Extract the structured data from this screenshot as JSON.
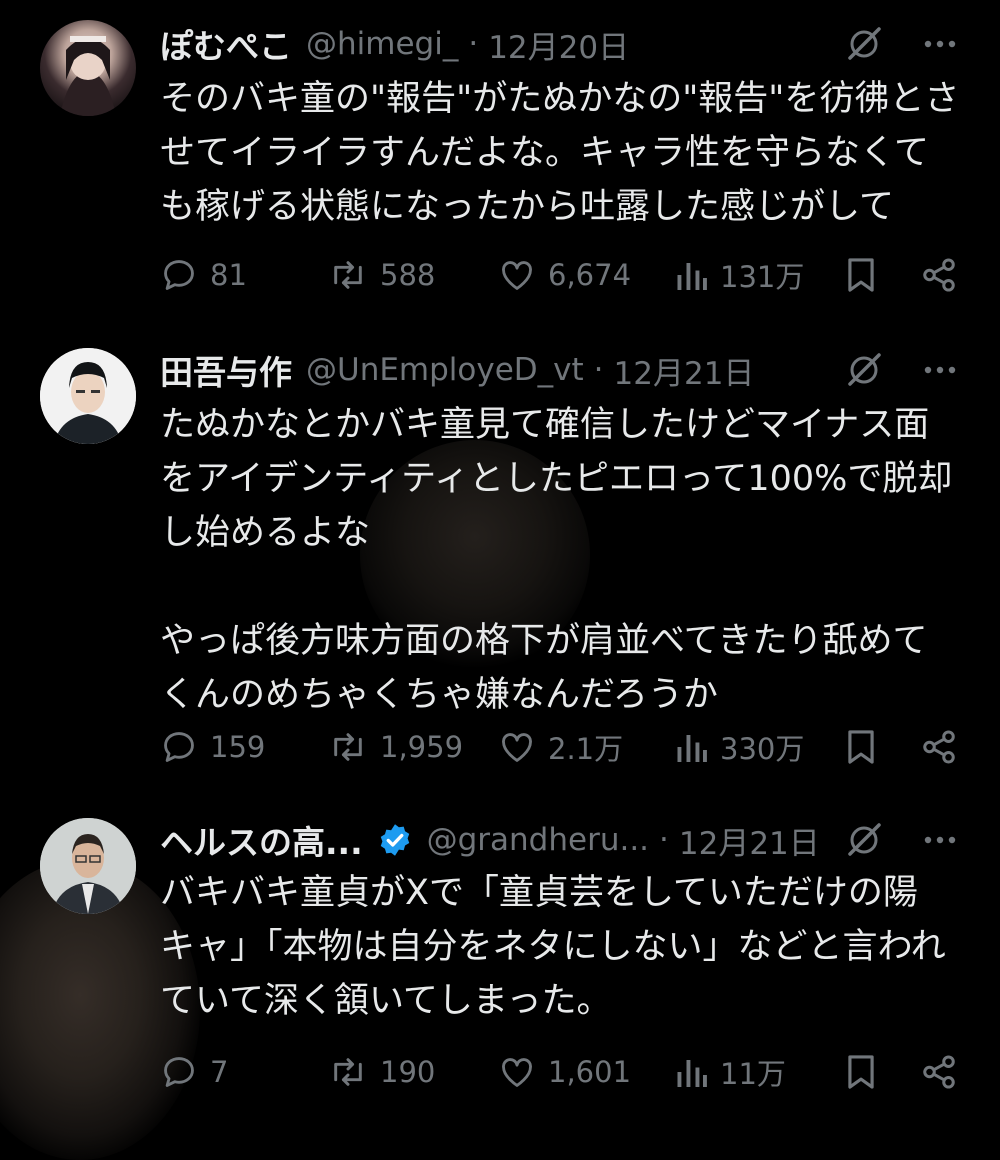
{
  "tweets": [
    {
      "name": "ぽむぺこ",
      "handle": "@himegi_",
      "separator": "·",
      "date": "12月20日",
      "verified": false,
      "text": [
        "そのバキ童の\"報告\"がたぬかなの\"報告\"を彷彿とさ",
        "せてイライラすんだよな。キャラ性を守らなくて",
        "も稼げる状態になったから吐露した感じがして"
      ],
      "stats": {
        "replies": "81",
        "reposts": "588",
        "likes": "6,674",
        "views": "131万"
      }
    },
    {
      "name": "田吾与作",
      "handle": "@UnEmployeD_vt",
      "separator": "·",
      "date": "12月21日",
      "verified": false,
      "text": [
        "たぬかなとかバキ童見て確信したけどマイナス面",
        "をアイデンティティとしたピエロって100%で脱却",
        "し始めるよな",
        "",
        "やっぱ後方味方面の格下が肩並べてきたり舐めて",
        "くんのめちゃくちゃ嫌なんだろうか"
      ],
      "stats": {
        "replies": "159",
        "reposts": "1,959",
        "likes": "2.1万",
        "views": "330万"
      }
    },
    {
      "name": "ヘルスの高...",
      "handle": "@grandheru...",
      "separator": "·",
      "date": "12月21日",
      "verified": true,
      "text": [
        "バキバキ童貞がXで「童貞芸をしていただけの陽",
        "キャ」「本物は自分をネタにしない」などと言われ",
        "ていて深く頷いてしまった。"
      ],
      "stats": {
        "replies": "7",
        "reposts": "190",
        "likes": "1,601",
        "views": "11万"
      }
    }
  ],
  "icons": {
    "grok": "grok-icon",
    "more": "more-icon",
    "reply": "reply-icon",
    "repost": "repost-icon",
    "like": "like-icon",
    "views": "views-icon",
    "bookmark": "bookmark-icon",
    "share": "share-icon",
    "verified": "verified-badge-icon"
  },
  "colors": {
    "background": "#000000",
    "text": "#e7e9ea",
    "muted": "#71767b",
    "verified": "#1d9bf0"
  }
}
